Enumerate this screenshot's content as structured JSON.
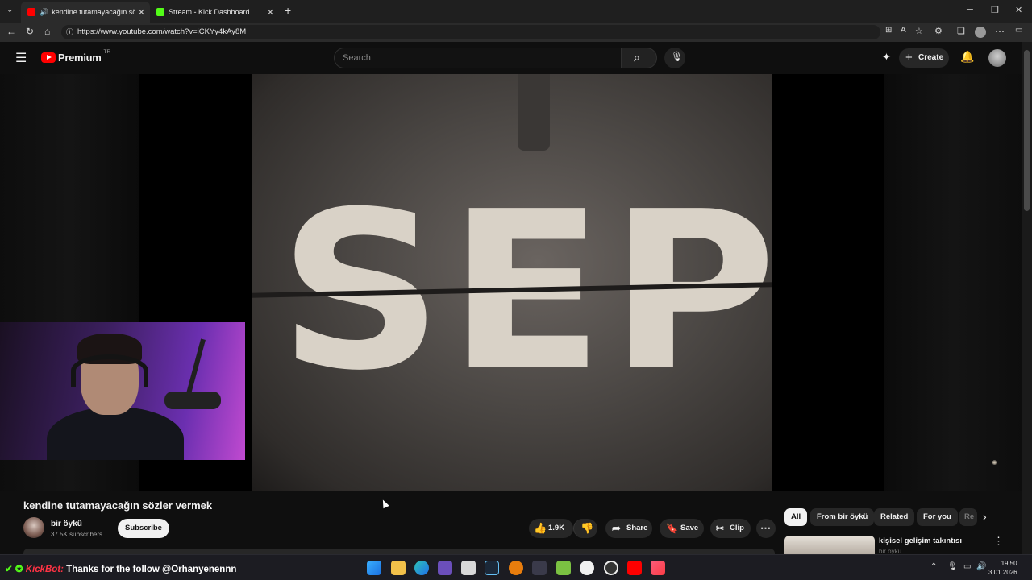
{
  "browser": {
    "tabs": [
      {
        "title": "kendine tutamayacağın sözle",
        "active": true
      },
      {
        "title": "Stream - Kick Dashboard",
        "active": false
      }
    ],
    "url": "https://www.youtube.com/watch?v=iCKYy4kAy8M"
  },
  "youtube": {
    "logo_text": "Premium",
    "region_badge": "TR",
    "search_placeholder": "Search",
    "create_label": "Create"
  },
  "video": {
    "frame_text": "SEP",
    "title": "kendine tutamayacağın sözler vermek",
    "channel": "bir öykü",
    "subscribers": "37.5K subscribers",
    "subscribe_label": "Subscribe",
    "like_count": "1.9K",
    "share_label": "Share",
    "save_label": "Save",
    "clip_label": "Clip"
  },
  "sidebar": {
    "chips": [
      "All",
      "From bir öykü",
      "Related",
      "For you",
      "Re"
    ],
    "first_item_title": "kişisel gelişim takıntısı",
    "first_item_channel": "bir öykü"
  },
  "taskbar": {
    "kickbot_name": "KickBot:",
    "kickbot_message": "Thanks for the follow @Orhanyenennn",
    "time": "19:50",
    "date": "3.01.2026"
  },
  "colors": {
    "youtube_red": "#ff0000",
    "kick_green": "#53fc18",
    "background": "#0f0f0f"
  }
}
